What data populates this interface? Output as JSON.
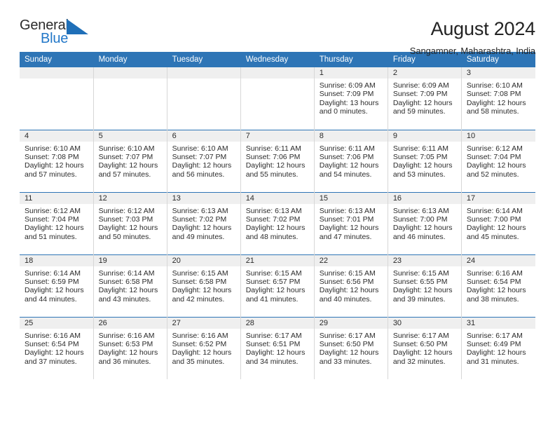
{
  "brand": {
    "name_top": "General",
    "name_bottom": "Blue",
    "flag_color": "#2277c8",
    "accent_color": "#2e75b6"
  },
  "header": {
    "title": "August 2024",
    "subtitle": "Sangamner, Maharashtra, India"
  },
  "weekday_headers": [
    "Sunday",
    "Monday",
    "Tuesday",
    "Wednesday",
    "Thursday",
    "Friday",
    "Saturday"
  ],
  "labels": {
    "sunrise_prefix": "Sunrise:",
    "sunset_prefix": "Sunset:",
    "daylight_prefix": "Daylight:"
  },
  "weeks": [
    [
      {
        "day": "",
        "line1": "",
        "line2": "",
        "line3": "",
        "line4": "",
        "empty": true
      },
      {
        "day": "",
        "line1": "",
        "line2": "",
        "line3": "",
        "line4": "",
        "empty": true
      },
      {
        "day": "",
        "line1": "",
        "line2": "",
        "line3": "",
        "line4": "",
        "empty": true
      },
      {
        "day": "",
        "line1": "",
        "line2": "",
        "line3": "",
        "line4": "",
        "empty": true
      },
      {
        "day": "1",
        "line1": "Sunrise: 6:09 AM",
        "line2": "Sunset: 7:09 PM",
        "line3": "Daylight: 13 hours",
        "line4": "and 0 minutes."
      },
      {
        "day": "2",
        "line1": "Sunrise: 6:09 AM",
        "line2": "Sunset: 7:09 PM",
        "line3": "Daylight: 12 hours",
        "line4": "and 59 minutes."
      },
      {
        "day": "3",
        "line1": "Sunrise: 6:10 AM",
        "line2": "Sunset: 7:08 PM",
        "line3": "Daylight: 12 hours",
        "line4": "and 58 minutes."
      }
    ],
    [
      {
        "day": "4",
        "line1": "Sunrise: 6:10 AM",
        "line2": "Sunset: 7:08 PM",
        "line3": "Daylight: 12 hours",
        "line4": "and 57 minutes."
      },
      {
        "day": "5",
        "line1": "Sunrise: 6:10 AM",
        "line2": "Sunset: 7:07 PM",
        "line3": "Daylight: 12 hours",
        "line4": "and 57 minutes."
      },
      {
        "day": "6",
        "line1": "Sunrise: 6:10 AM",
        "line2": "Sunset: 7:07 PM",
        "line3": "Daylight: 12 hours",
        "line4": "and 56 minutes."
      },
      {
        "day": "7",
        "line1": "Sunrise: 6:11 AM",
        "line2": "Sunset: 7:06 PM",
        "line3": "Daylight: 12 hours",
        "line4": "and 55 minutes."
      },
      {
        "day": "8",
        "line1": "Sunrise: 6:11 AM",
        "line2": "Sunset: 7:06 PM",
        "line3": "Daylight: 12 hours",
        "line4": "and 54 minutes."
      },
      {
        "day": "9",
        "line1": "Sunrise: 6:11 AM",
        "line2": "Sunset: 7:05 PM",
        "line3": "Daylight: 12 hours",
        "line4": "and 53 minutes."
      },
      {
        "day": "10",
        "line1": "Sunrise: 6:12 AM",
        "line2": "Sunset: 7:04 PM",
        "line3": "Daylight: 12 hours",
        "line4": "and 52 minutes."
      }
    ],
    [
      {
        "day": "11",
        "line1": "Sunrise: 6:12 AM",
        "line2": "Sunset: 7:04 PM",
        "line3": "Daylight: 12 hours",
        "line4": "and 51 minutes."
      },
      {
        "day": "12",
        "line1": "Sunrise: 6:12 AM",
        "line2": "Sunset: 7:03 PM",
        "line3": "Daylight: 12 hours",
        "line4": "and 50 minutes."
      },
      {
        "day": "13",
        "line1": "Sunrise: 6:13 AM",
        "line2": "Sunset: 7:02 PM",
        "line3": "Daylight: 12 hours",
        "line4": "and 49 minutes."
      },
      {
        "day": "14",
        "line1": "Sunrise: 6:13 AM",
        "line2": "Sunset: 7:02 PM",
        "line3": "Daylight: 12 hours",
        "line4": "and 48 minutes."
      },
      {
        "day": "15",
        "line1": "Sunrise: 6:13 AM",
        "line2": "Sunset: 7:01 PM",
        "line3": "Daylight: 12 hours",
        "line4": "and 47 minutes."
      },
      {
        "day": "16",
        "line1": "Sunrise: 6:13 AM",
        "line2": "Sunset: 7:00 PM",
        "line3": "Daylight: 12 hours",
        "line4": "and 46 minutes."
      },
      {
        "day": "17",
        "line1": "Sunrise: 6:14 AM",
        "line2": "Sunset: 7:00 PM",
        "line3": "Daylight: 12 hours",
        "line4": "and 45 minutes."
      }
    ],
    [
      {
        "day": "18",
        "line1": "Sunrise: 6:14 AM",
        "line2": "Sunset: 6:59 PM",
        "line3": "Daylight: 12 hours",
        "line4": "and 44 minutes."
      },
      {
        "day": "19",
        "line1": "Sunrise: 6:14 AM",
        "line2": "Sunset: 6:58 PM",
        "line3": "Daylight: 12 hours",
        "line4": "and 43 minutes."
      },
      {
        "day": "20",
        "line1": "Sunrise: 6:15 AM",
        "line2": "Sunset: 6:58 PM",
        "line3": "Daylight: 12 hours",
        "line4": "and 42 minutes."
      },
      {
        "day": "21",
        "line1": "Sunrise: 6:15 AM",
        "line2": "Sunset: 6:57 PM",
        "line3": "Daylight: 12 hours",
        "line4": "and 41 minutes."
      },
      {
        "day": "22",
        "line1": "Sunrise: 6:15 AM",
        "line2": "Sunset: 6:56 PM",
        "line3": "Daylight: 12 hours",
        "line4": "and 40 minutes."
      },
      {
        "day": "23",
        "line1": "Sunrise: 6:15 AM",
        "line2": "Sunset: 6:55 PM",
        "line3": "Daylight: 12 hours",
        "line4": "and 39 minutes."
      },
      {
        "day": "24",
        "line1": "Sunrise: 6:16 AM",
        "line2": "Sunset: 6:54 PM",
        "line3": "Daylight: 12 hours",
        "line4": "and 38 minutes."
      }
    ],
    [
      {
        "day": "25",
        "line1": "Sunrise: 6:16 AM",
        "line2": "Sunset: 6:54 PM",
        "line3": "Daylight: 12 hours",
        "line4": "and 37 minutes."
      },
      {
        "day": "26",
        "line1": "Sunrise: 6:16 AM",
        "line2": "Sunset: 6:53 PM",
        "line3": "Daylight: 12 hours",
        "line4": "and 36 minutes."
      },
      {
        "day": "27",
        "line1": "Sunrise: 6:16 AM",
        "line2": "Sunset: 6:52 PM",
        "line3": "Daylight: 12 hours",
        "line4": "and 35 minutes."
      },
      {
        "day": "28",
        "line1": "Sunrise: 6:17 AM",
        "line2": "Sunset: 6:51 PM",
        "line3": "Daylight: 12 hours",
        "line4": "and 34 minutes."
      },
      {
        "day": "29",
        "line1": "Sunrise: 6:17 AM",
        "line2": "Sunset: 6:50 PM",
        "line3": "Daylight: 12 hours",
        "line4": "and 33 minutes."
      },
      {
        "day": "30",
        "line1": "Sunrise: 6:17 AM",
        "line2": "Sunset: 6:50 PM",
        "line3": "Daylight: 12 hours",
        "line4": "and 32 minutes."
      },
      {
        "day": "31",
        "line1": "Sunrise: 6:17 AM",
        "line2": "Sunset: 6:49 PM",
        "line3": "Daylight: 12 hours",
        "line4": "and 31 minutes."
      }
    ]
  ]
}
